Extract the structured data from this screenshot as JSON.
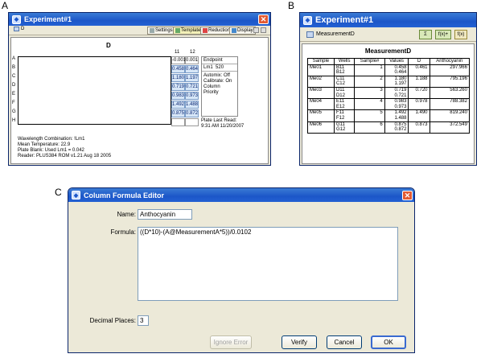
{
  "panel_labels": {
    "a": "A",
    "b": "B",
    "c": "C"
  },
  "panelA": {
    "window_title": "Experiment#1",
    "tab_label": "D",
    "toolbar": {
      "settings": "Settings",
      "template": "Template",
      "reduction": "Reduction",
      "display": "Display"
    },
    "plate_title": "D",
    "col_headers": [
      "11",
      "12"
    ],
    "row_labels": [
      "A",
      "B",
      "C",
      "D",
      "E",
      "F",
      "G",
      "H"
    ],
    "col11": [
      "-0.001",
      "0.458",
      "1.180",
      "0.719",
      "0.983",
      "1.492",
      "0.875",
      ""
    ],
    "col12": [
      "0.001",
      "0.464",
      "1.197",
      "0.721",
      "0.973",
      "1.488",
      "0.872",
      ""
    ],
    "endpoint": {
      "mode": "Endpoint",
      "lm": "Lm1",
      "wavelength": "520",
      "automix": "Automix: Off",
      "calibrate": "Calibrate: On",
      "priority": "Column Priority"
    },
    "plate_last_read_label": "Plate Last Read:",
    "plate_last_read_value": "9:31 AM 11/20/2007",
    "info_lines": [
      "Wavelength Combination: !Lm1",
      "Mean Temperature: 22.9",
      "Plate Blank: Used   Lm1 = 0.042",
      "Reader: PLUS384 ROM v1.21 Aug 18 2005"
    ]
  },
  "panelB": {
    "window_title": "Experiment#1",
    "sub_title": "MeasurementD",
    "buttons": [
      "Σ",
      "f(x)+",
      "f(x)"
    ],
    "table_title": "MeasurementD",
    "headers": [
      "Sample",
      "Wells",
      "Sample#",
      "Values",
      "D",
      "Anthocyanin"
    ],
    "groups": [
      {
        "sample": "Me01",
        "wells": [
          "B11",
          "B12"
        ],
        "num": "1",
        "values": [
          "0.458",
          "0.464"
        ],
        "d": "0.461",
        "anth": "297.966"
      },
      {
        "sample": "Me02",
        "wells": [
          "C11",
          "C12"
        ],
        "num": "2",
        "values": [
          "1.180",
          "1.197"
        ],
        "d": "1.188",
        "anth": "795.196"
      },
      {
        "sample": "Me03",
        "wells": [
          "D11",
          "D12"
        ],
        "num": "3",
        "values": [
          "0.719",
          "0.721"
        ],
        "d": "0.720",
        "anth": "563.260"
      },
      {
        "sample": "Me04",
        "wells": [
          "E11",
          "E12"
        ],
        "num": "4",
        "values": [
          "0.983",
          "0.973"
        ],
        "d": "0.978",
        "anth": "788.382"
      },
      {
        "sample": "Me05",
        "wells": [
          "F11",
          "F12"
        ],
        "num": "5",
        "values": [
          "1.492",
          "1.488"
        ],
        "d": "1.490",
        "anth": "819.240"
      },
      {
        "sample": "Me06",
        "wells": [
          "G11",
          "G12"
        ],
        "num": "6",
        "values": [
          "0.875",
          "0.872"
        ],
        "d": "0.873",
        "anth": "372.549"
      }
    ]
  },
  "panelC": {
    "window_title": "Column Formula Editor",
    "name_label": "Name:",
    "name_value": "Anthocyanin",
    "formula_label": "Formula:",
    "formula_value": "((D*10)-(A@MeasurementA*5))/0.0102",
    "decimal_label": "Decimal Places:",
    "decimal_value": "3",
    "buttons": {
      "ignore_error": "Ignore Error",
      "verify": "Verify",
      "cancel": "Cancel",
      "ok": "OK"
    }
  }
}
